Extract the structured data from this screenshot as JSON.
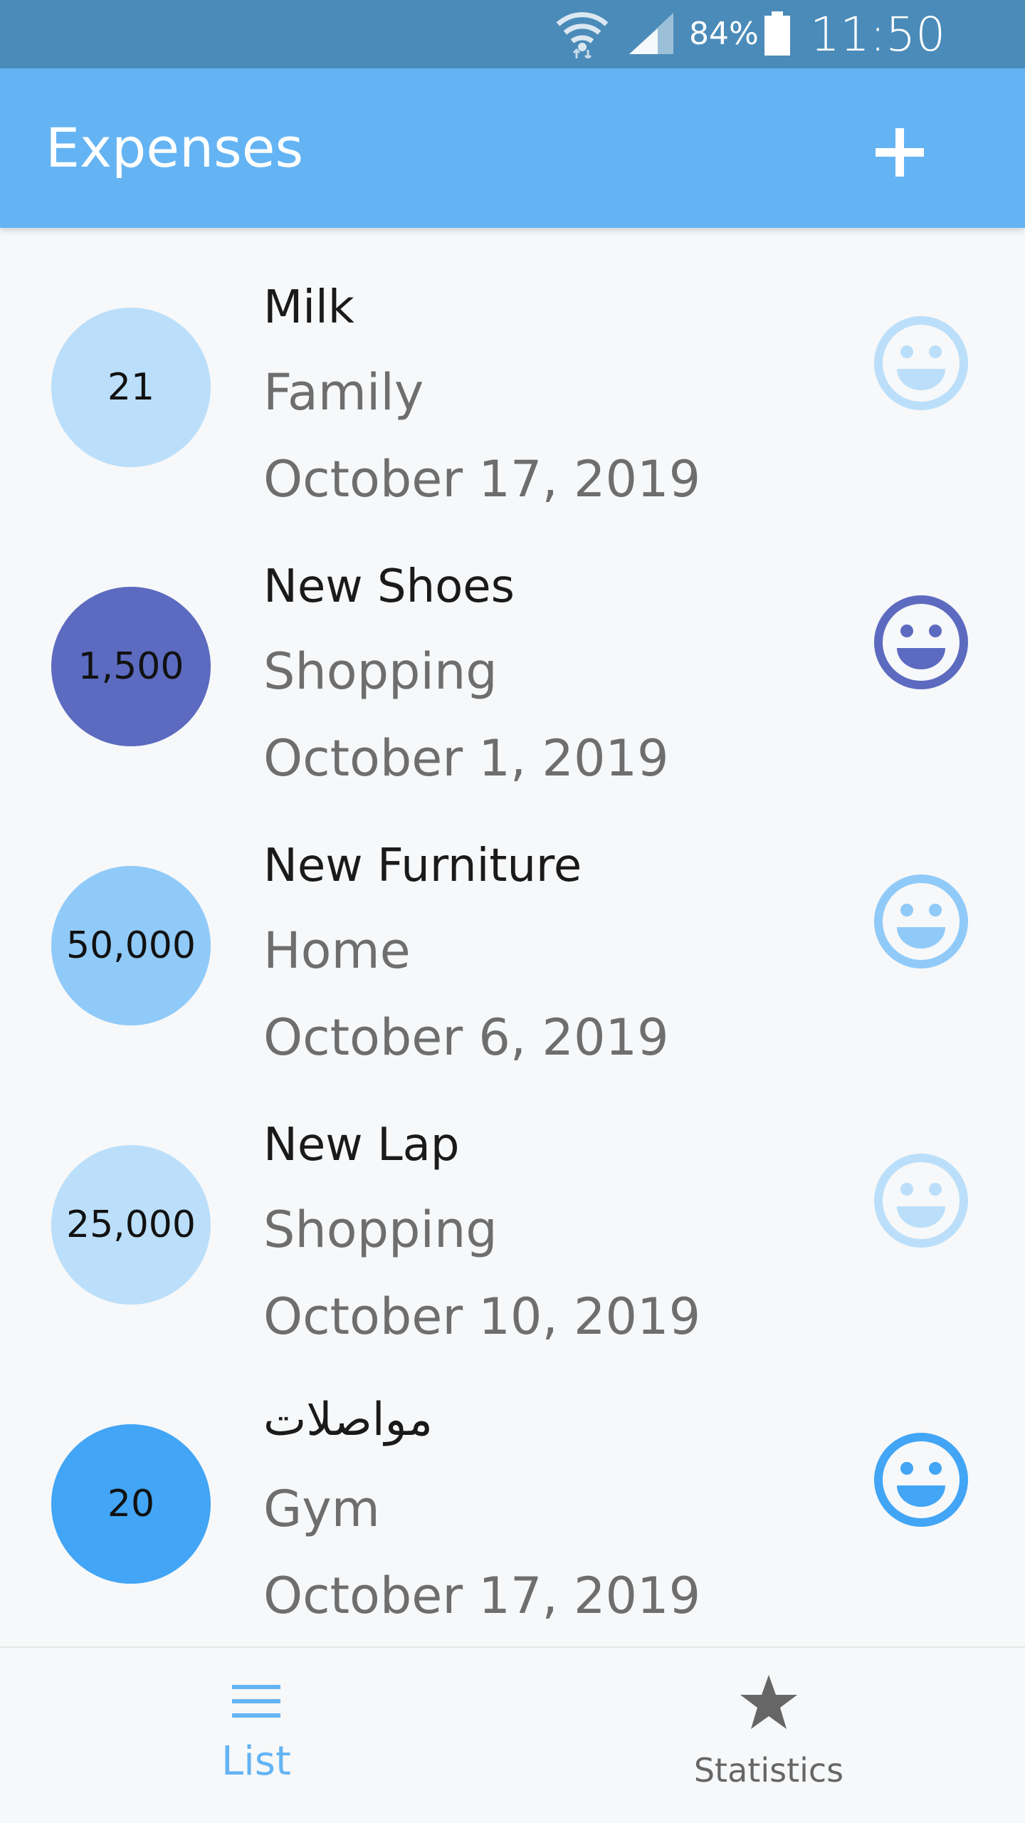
{
  "status_bar": {
    "battery": "84%",
    "time": "11:50 PM",
    "icons": [
      "wifi-icon",
      "signal-icon",
      "battery-icon"
    ]
  },
  "app_bar": {
    "title": "Expenses",
    "add_icon": "plus-icon"
  },
  "colors": {
    "status_bar": "#4b8bb9",
    "app_bar": "#64b4f4",
    "active_tab": "#64b4f4",
    "inactive_tab": "#666666"
  },
  "expenses": [
    {
      "amount": "21",
      "title": "Milk",
      "category": "Family",
      "date": "October 17, 2019",
      "color": "#bbdffa",
      "icon": "smiley-icon"
    },
    {
      "amount": "1,500",
      "title": "New Shoes",
      "category": "Shopping",
      "date": "October 1, 2019",
      "color": "#5c6bc0",
      "icon": "smiley-icon"
    },
    {
      "amount": "50,000",
      "title": "New Furniture",
      "category": "Home",
      "date": "October 6, 2019",
      "color": "#90caf9",
      "icon": "smiley-icon"
    },
    {
      "amount": "25,000",
      "title": "New Lap",
      "category": "Shopping",
      "date": "October 10, 2019",
      "color": "#bbdffa",
      "icon": "smiley-icon"
    },
    {
      "amount": "20",
      "title": "مواصلات",
      "category": "Gym",
      "date": "October 17, 2019",
      "color": "#42a5f5",
      "icon": "smiley-icon"
    }
  ],
  "bottom_nav": {
    "tabs": [
      {
        "label": "List",
        "icon": "list-icon",
        "active": true
      },
      {
        "label": "Statistics",
        "icon": "star-icon",
        "active": false
      }
    ]
  }
}
